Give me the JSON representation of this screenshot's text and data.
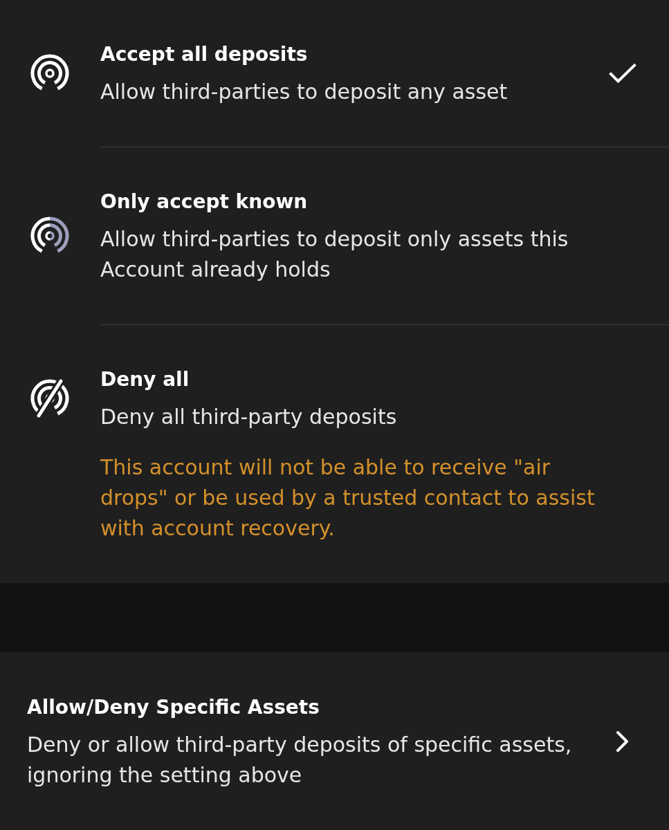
{
  "options": [
    {
      "kind": "all",
      "title": "Accept all deposits",
      "description": "Allow third-parties to deposit any asset",
      "selected": true
    },
    {
      "kind": "known",
      "title": "Only accept known",
      "description": "Allow third-parties to deposit only assets this Account already holds",
      "selected": false
    },
    {
      "kind": "deny",
      "title": "Deny all",
      "description": "Deny all third-party deposits",
      "warning": "This account will not be able to receive \"air drops\" or be used by a trusted contact to assist with account recovery.",
      "selected": false
    }
  ],
  "specific_assets": {
    "title": "Allow/Deny Specific Assets",
    "description": "Deny or allow third-party deposits of specific assets, ignoring the setting above"
  }
}
